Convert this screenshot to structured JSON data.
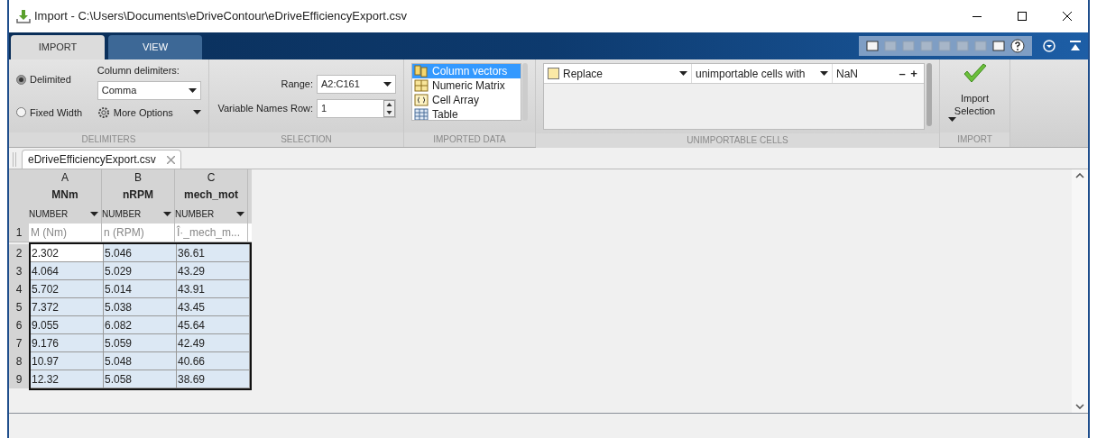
{
  "window": {
    "title": "Import - C:\\Users\\Documents\\eDriveContour\\eDriveEfficiencyExport.csv"
  },
  "tabs": [
    {
      "label": "IMPORT",
      "selected": true
    },
    {
      "label": "VIEW",
      "selected": false
    }
  ],
  "delimiters": {
    "section": "DELIMITERS",
    "options": [
      {
        "label": "Delimited",
        "selected": true
      },
      {
        "label": "Fixed Width",
        "selected": false
      }
    ],
    "column_delimiters_label": "Column delimiters:",
    "column_delimiters_value": "Comma",
    "more_options": "More Options"
  },
  "selection": {
    "section": "SELECTION",
    "range_label": "Range:",
    "range_value": "A2:C161",
    "names_row_label": "Variable Names Row:",
    "names_row_value": "1"
  },
  "imported_data": {
    "section": "IMPORTED DATA",
    "items": [
      {
        "label": "Column vectors",
        "kind": "vectors",
        "selected": true
      },
      {
        "label": "Numeric Matrix",
        "kind": "matrix",
        "selected": false
      },
      {
        "label": "Cell Array",
        "kind": "cell",
        "selected": false
      },
      {
        "label": "Table",
        "kind": "table",
        "selected": false
      }
    ]
  },
  "unimportable": {
    "section": "UNIMPORTABLE CELLS",
    "action": "Replace",
    "checked": false,
    "target": "unimportable cells with",
    "value": "NaN",
    "remove": "–",
    "add": "+"
  },
  "import": {
    "section": "IMPORT",
    "button": "Import Selection"
  },
  "document_tab": {
    "label": "eDriveEfficiencyExport.csv"
  },
  "table": {
    "columns": [
      {
        "letter": "A",
        "name": "MNm",
        "type": "NUMBER",
        "unit": "M (Nm)"
      },
      {
        "letter": "B",
        "name": "nRPM",
        "type": "NUMBER",
        "unit": "n (RPM)"
      },
      {
        "letter": "C",
        "name": "mech_mot",
        "type": "NUMBER",
        "unit": "Î·_mech_m..."
      }
    ],
    "unit_row_number": "1",
    "rows": [
      {
        "number": "2",
        "cells": [
          "2.302",
          "5.046",
          "36.61"
        ],
        "selected": true
      },
      {
        "number": "3",
        "cells": [
          "4.064",
          "5.029",
          "43.29"
        ],
        "selected": true
      },
      {
        "number": "4",
        "cells": [
          "5.702",
          "5.014",
          "43.91"
        ],
        "selected": true
      },
      {
        "number": "5",
        "cells": [
          "7.372",
          "5.038",
          "43.45"
        ],
        "selected": true
      },
      {
        "number": "6",
        "cells": [
          "9.055",
          "6.082",
          "45.64"
        ],
        "selected": true
      },
      {
        "number": "7",
        "cells": [
          "9.176",
          "5.059",
          "42.49"
        ],
        "selected": true
      },
      {
        "number": "8",
        "cells": [
          "10.97",
          "5.048",
          "40.66"
        ],
        "selected": true
      },
      {
        "number": "9",
        "cells": [
          "12.32",
          "5.058",
          "38.69"
        ],
        "selected": true
      }
    ]
  }
}
